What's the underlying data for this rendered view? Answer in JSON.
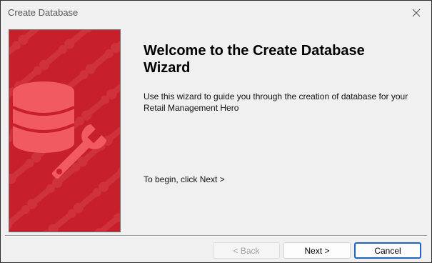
{
  "window": {
    "title": "Create Database",
    "close_glyph": "✕"
  },
  "content": {
    "heading_line1": "Welcome to the Create Database",
    "heading_line2": "Wizard",
    "description_line1": "Use this wizard to guide you through the creation of database for your",
    "description_line2": "Retail Management Hero",
    "begin_text": "To begin, click Next >"
  },
  "buttons": {
    "back_label": "< Back",
    "next_label": "Next >",
    "cancel_label": "Cancel"
  },
  "banner": {
    "icons": [
      "database-icon",
      "wrench-icon"
    ],
    "colors": {
      "background": "#c8202b",
      "pattern": "#d63a43",
      "icon": "#f15a5f"
    }
  }
}
